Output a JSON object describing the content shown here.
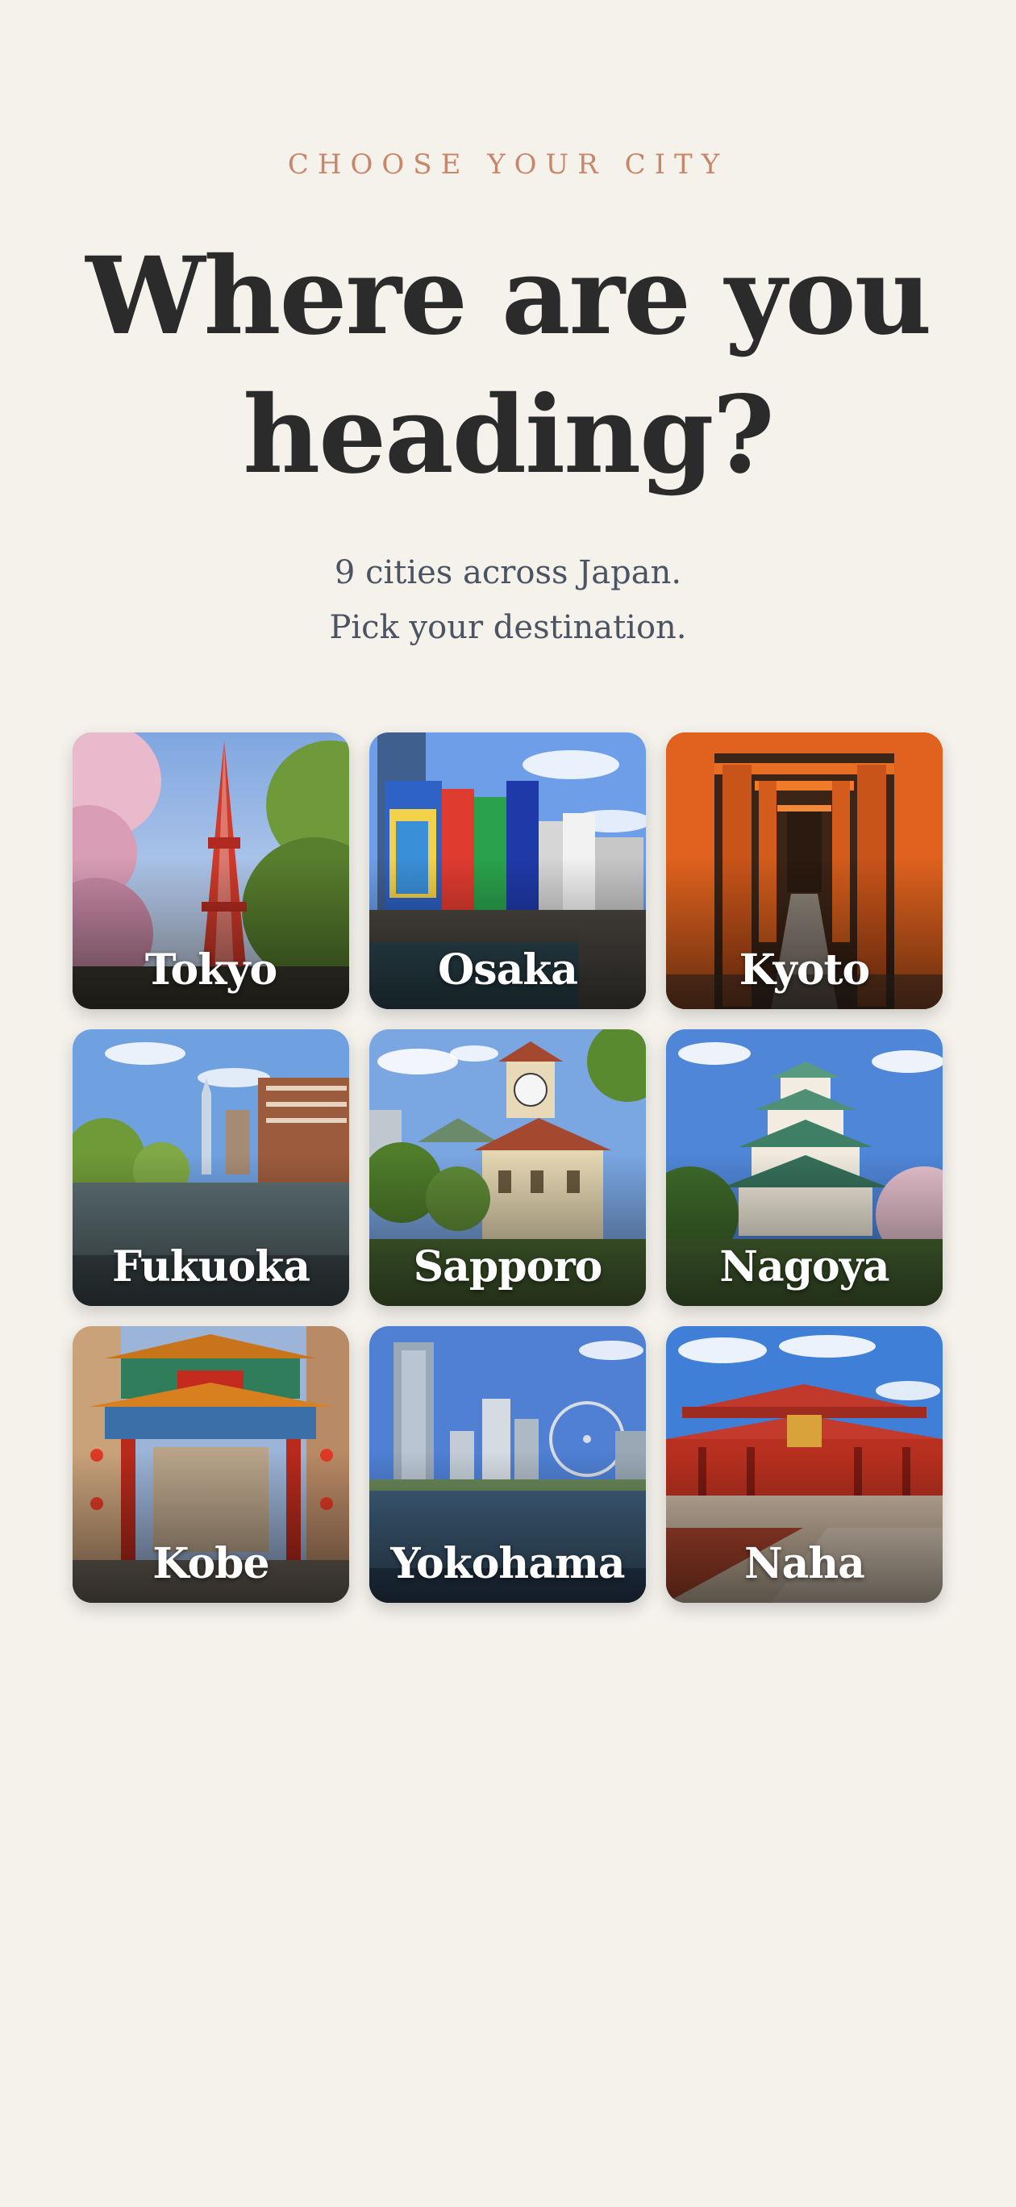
{
  "header": {
    "eyebrow": "CHOOSE YOUR CITY",
    "title": "Where are you heading?",
    "subtitle_line1": "9 cities across Japan.",
    "subtitle_line2": "Pick your destination."
  },
  "colors": {
    "background": "#f5f2ec",
    "eyebrow": "#c8866a",
    "title": "#2b2b2b",
    "subtitle": "#4a5463",
    "card_label": "#ffffff"
  },
  "cities": [
    {
      "name": "Tokyo",
      "icon": "tokyo-tower-image"
    },
    {
      "name": "Osaka",
      "icon": "dotonbori-image"
    },
    {
      "name": "Kyoto",
      "icon": "torii-gates-image"
    },
    {
      "name": "Fukuoka",
      "icon": "river-skyline-image"
    },
    {
      "name": "Sapporo",
      "icon": "clock-tower-image"
    },
    {
      "name": "Nagoya",
      "icon": "castle-image"
    },
    {
      "name": "Kobe",
      "icon": "chinatown-gate-image"
    },
    {
      "name": "Yokohama",
      "icon": "harbor-skyline-image"
    },
    {
      "name": "Naha",
      "icon": "shuri-castle-image"
    }
  ]
}
